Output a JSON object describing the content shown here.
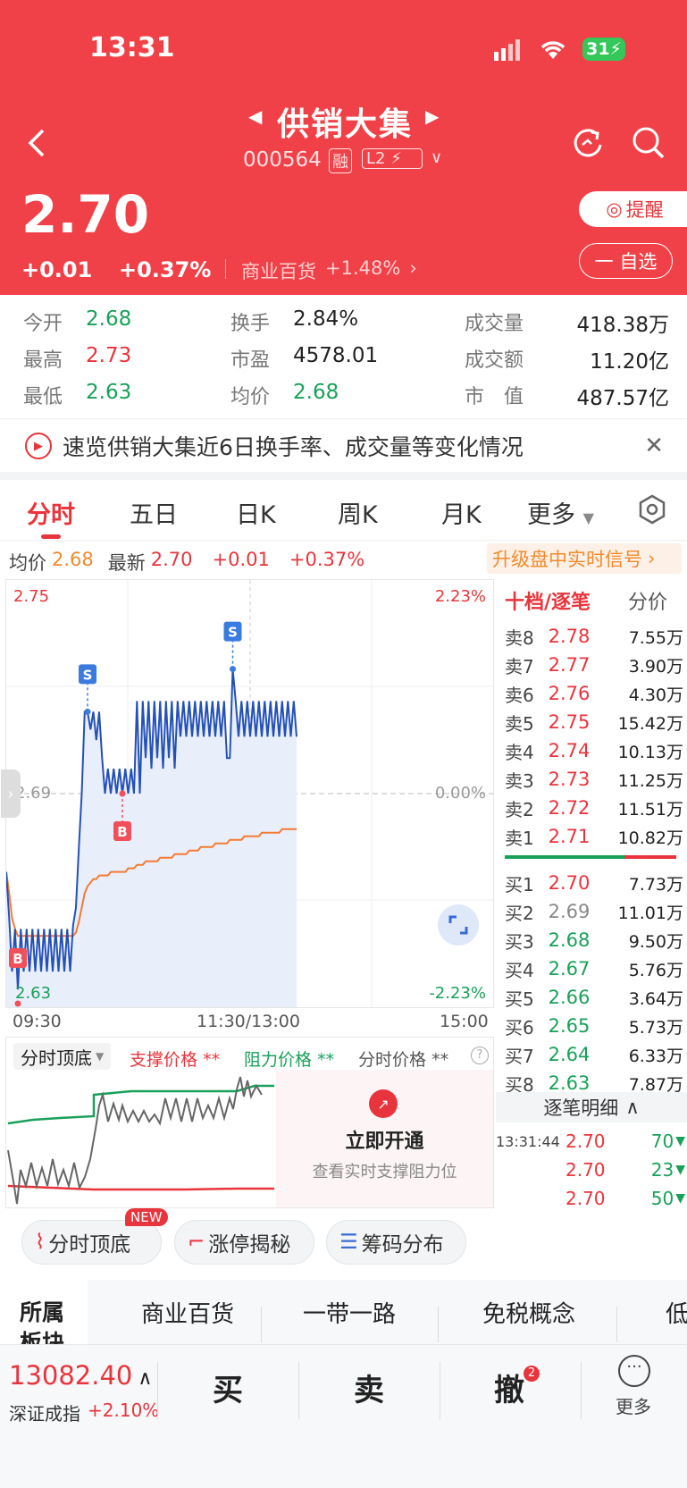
{
  "status_bar": {
    "time": "13:31",
    "battery": "31"
  },
  "header": {
    "title": "供销大集",
    "code": "000564",
    "rong_badge": "融",
    "l2_badge": "L2",
    "price": "2.70",
    "change": "+0.01",
    "change_pct": "+0.37%",
    "sector": "商业百货",
    "sector_pct": "+1.48%",
    "remind_label": "提醒",
    "watch_label": "一 自选"
  },
  "stats": [
    {
      "l1": "今开",
      "v1": "2.68",
      "l2": "换手",
      "v2": "2.84%",
      "l3": "成交量",
      "v3": "418.38万"
    },
    {
      "l1": "最高",
      "v1": "2.73",
      "l2": "市盈",
      "v2": "4578.01",
      "l3": "成交额",
      "v3": "11.20亿"
    },
    {
      "l1": "最低",
      "v1": "2.63",
      "l2": "均价",
      "v2": "2.68",
      "l3": "市　值",
      "v3": "487.57亿"
    }
  ],
  "banner": {
    "text": "速览供销大集近6日换手率、成交量等变化情况"
  },
  "tabs": [
    "分时",
    "五日",
    "日K",
    "周K",
    "月K",
    "更多"
  ],
  "info_line": {
    "avg_label": "均价",
    "avg": "2.68",
    "latest_label": "最新",
    "latest": "2.70",
    "chg": "+0.01",
    "pct": "+0.37%",
    "upgrade": "升级盘中实时信号"
  },
  "chart": {
    "y_top": "2.75",
    "y_mid": "2.69",
    "y_bot": "2.63",
    "pct_top": "2.23%",
    "pct_mid": "0.00%",
    "pct_bot": "-2.23%",
    "x_start": "09:30",
    "x_mid": "11:30/13:00",
    "x_end": "15:00",
    "marker_s": "S",
    "marker_b": "B"
  },
  "chart_data": {
    "type": "line",
    "series": [
      {
        "name": "最新",
        "values": [
          2.668,
          2.655,
          2.64,
          2.652,
          2.635,
          2.652,
          2.64,
          2.652,
          2.64,
          2.652,
          2.64,
          2.652,
          2.64,
          2.652,
          2.64,
          2.652,
          2.64,
          2.652,
          2.64,
          2.652,
          2.64,
          2.652,
          2.64,
          2.653,
          2.658,
          2.675,
          2.69,
          2.713,
          2.713,
          2.708,
          2.713,
          2.705,
          2.713,
          2.7,
          2.69,
          2.697,
          2.69,
          2.697,
          2.69,
          2.697,
          2.69,
          2.697,
          2.69,
          2.697,
          2.69,
          2.716,
          2.69,
          2.716,
          2.7,
          2.716,
          2.697,
          2.716,
          2.7,
          2.716,
          2.697,
          2.716,
          2.7,
          2.716,
          2.697,
          2.716,
          2.706,
          2.716,
          2.706,
          2.716,
          2.706,
          2.716,
          2.706,
          2.716,
          2.706,
          2.716,
          2.706,
          2.716,
          2.706,
          2.716,
          2.706,
          2.716,
          2.7,
          2.7,
          2.725,
          2.716,
          2.706,
          2.716,
          2.706,
          2.716,
          2.706,
          2.716,
          2.706,
          2.716,
          2.706,
          2.716,
          2.706,
          2.716,
          2.706,
          2.716,
          2.706,
          2.716,
          2.706,
          2.716,
          2.706,
          2.716,
          2.706
        ]
      },
      {
        "name": "均价",
        "values": [
          2.668,
          2.662,
          2.655,
          2.652,
          2.65,
          2.65,
          2.65,
          2.65,
          2.65,
          2.65,
          2.65,
          2.65,
          2.65,
          2.65,
          2.65,
          2.65,
          2.65,
          2.65,
          2.65,
          2.65,
          2.65,
          2.65,
          2.65,
          2.65,
          2.651,
          2.654,
          2.658,
          2.662,
          2.664,
          2.665,
          2.666,
          2.666,
          2.667,
          2.667,
          2.667,
          2.667,
          2.668,
          2.668,
          2.668,
          2.668,
          2.668,
          2.668,
          2.669,
          2.669,
          2.669,
          2.67,
          2.67,
          2.67,
          2.671,
          2.671,
          2.671,
          2.671,
          2.671,
          2.672,
          2.672,
          2.672,
          2.672,
          2.672,
          2.673,
          2.673,
          2.673,
          2.673,
          2.673,
          2.674,
          2.674,
          2.674,
          2.674,
          2.675,
          2.675,
          2.675,
          2.675,
          2.675,
          2.676,
          2.676,
          2.676,
          2.676,
          2.676,
          2.677,
          2.677,
          2.677,
          2.677,
          2.677,
          2.678,
          2.678,
          2.678,
          2.678,
          2.678,
          2.678,
          2.679,
          2.679,
          2.679,
          2.679,
          2.679,
          2.679,
          2.679,
          2.68,
          2.68,
          2.68,
          2.68,
          2.68,
          2.68
        ]
      }
    ],
    "ylim": [
      2.63,
      2.75
    ]
  },
  "orderbook": {
    "title": "十档/逐笔",
    "subtitle": "分价",
    "sells": [
      {
        "l": "卖8",
        "p": "2.78",
        "v": "7.55万"
      },
      {
        "l": "卖7",
        "p": "2.77",
        "v": "3.90万"
      },
      {
        "l": "卖6",
        "p": "2.76",
        "v": "4.30万"
      },
      {
        "l": "卖5",
        "p": "2.75",
        "v": "15.42万"
      },
      {
        "l": "卖4",
        "p": "2.74",
        "v": "10.13万"
      },
      {
        "l": "卖3",
        "p": "2.73",
        "v": "11.25万"
      },
      {
        "l": "卖2",
        "p": "2.72",
        "v": "11.51万"
      },
      {
        "l": "卖1",
        "p": "2.71",
        "v": "10.82万"
      }
    ],
    "buys": [
      {
        "l": "买1",
        "p": "2.70",
        "v": "7.73万"
      },
      {
        "l": "买2",
        "p": "2.69",
        "v": "11.01万"
      },
      {
        "l": "买3",
        "p": "2.68",
        "v": "9.50万"
      },
      {
        "l": "买4",
        "p": "2.67",
        "v": "5.76万"
      },
      {
        "l": "买5",
        "p": "2.66",
        "v": "3.64万"
      },
      {
        "l": "买6",
        "p": "2.65",
        "v": "5.73万"
      },
      {
        "l": "买7",
        "p": "2.64",
        "v": "6.33万"
      },
      {
        "l": "买8",
        "p": "2.63",
        "v": "7.87万"
      }
    ],
    "detail_title": "逐笔明细",
    "ticks": [
      {
        "t": "13:31:44",
        "p": "2.70",
        "v": "70"
      },
      {
        "t": "",
        "p": "2.70",
        "v": "23"
      },
      {
        "t": "",
        "p": "2.70",
        "v": "50"
      }
    ]
  },
  "indicator": {
    "name": "分时顶底",
    "support": "支撑价格",
    "resist": "阻力价格",
    "price": "分时价格",
    "stars": "**",
    "open_btn": "立即开通",
    "open_desc": "查看实时支撑阻力位"
  },
  "chips": [
    {
      "label": "分时顶底",
      "badge": "NEW"
    },
    {
      "label": "涨停揭秘"
    },
    {
      "label": "筹码分布"
    }
  ],
  "sectors": {
    "label_line1": "所属",
    "label_line2": "板块",
    "items": [
      "商业百货",
      "一带一路",
      "免税概念",
      "低"
    ]
  },
  "bottom": {
    "index_val": "13082.40",
    "index_name": "深证成指",
    "index_pct": "+2.10%",
    "buy": "买",
    "sell": "卖",
    "cancel": "撤",
    "cancel_badge": "2",
    "more": "更多"
  }
}
